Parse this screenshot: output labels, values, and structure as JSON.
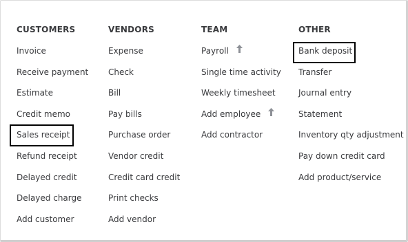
{
  "menu": {
    "columns": [
      {
        "heading": "CUSTOMERS",
        "items": [
          {
            "label": "Invoice"
          },
          {
            "label": "Receive payment"
          },
          {
            "label": "Estimate"
          },
          {
            "label": "Credit memo"
          },
          {
            "label": "Sales receipt"
          },
          {
            "label": "Refund receipt"
          },
          {
            "label": "Delayed credit"
          },
          {
            "label": "Delayed charge"
          },
          {
            "label": "Add customer"
          }
        ]
      },
      {
        "heading": "VENDORS",
        "items": [
          {
            "label": "Expense"
          },
          {
            "label": "Check"
          },
          {
            "label": "Bill"
          },
          {
            "label": "Pay bills"
          },
          {
            "label": "Purchase order"
          },
          {
            "label": "Vendor credit"
          },
          {
            "label": "Credit card credit"
          },
          {
            "label": "Print checks"
          },
          {
            "label": "Add vendor"
          }
        ]
      },
      {
        "heading": "TEAM",
        "items": [
          {
            "label": "Payroll",
            "icon": "upgrade-arrow-icon"
          },
          {
            "label": "Single time activity"
          },
          {
            "label": "Weekly timesheet"
          },
          {
            "label": "Add employee",
            "icon": "upgrade-arrow-icon"
          },
          {
            "label": "Add contractor"
          }
        ]
      },
      {
        "heading": "OTHER",
        "items": [
          {
            "label": "Bank deposit"
          },
          {
            "label": "Transfer"
          },
          {
            "label": "Journal entry"
          },
          {
            "label": "Statement"
          },
          {
            "label": "Inventory qty adjustment"
          },
          {
            "label": "Pay down credit card"
          },
          {
            "label": "Add product/service"
          }
        ]
      }
    ],
    "highlighted_items": [
      "Sales receipt",
      "Bank deposit"
    ]
  },
  "colors": {
    "text": "#393a3d",
    "heading": "#393a3d",
    "icon": "#8d9096",
    "highlight_border": "#000000",
    "background": "#ffffff"
  }
}
